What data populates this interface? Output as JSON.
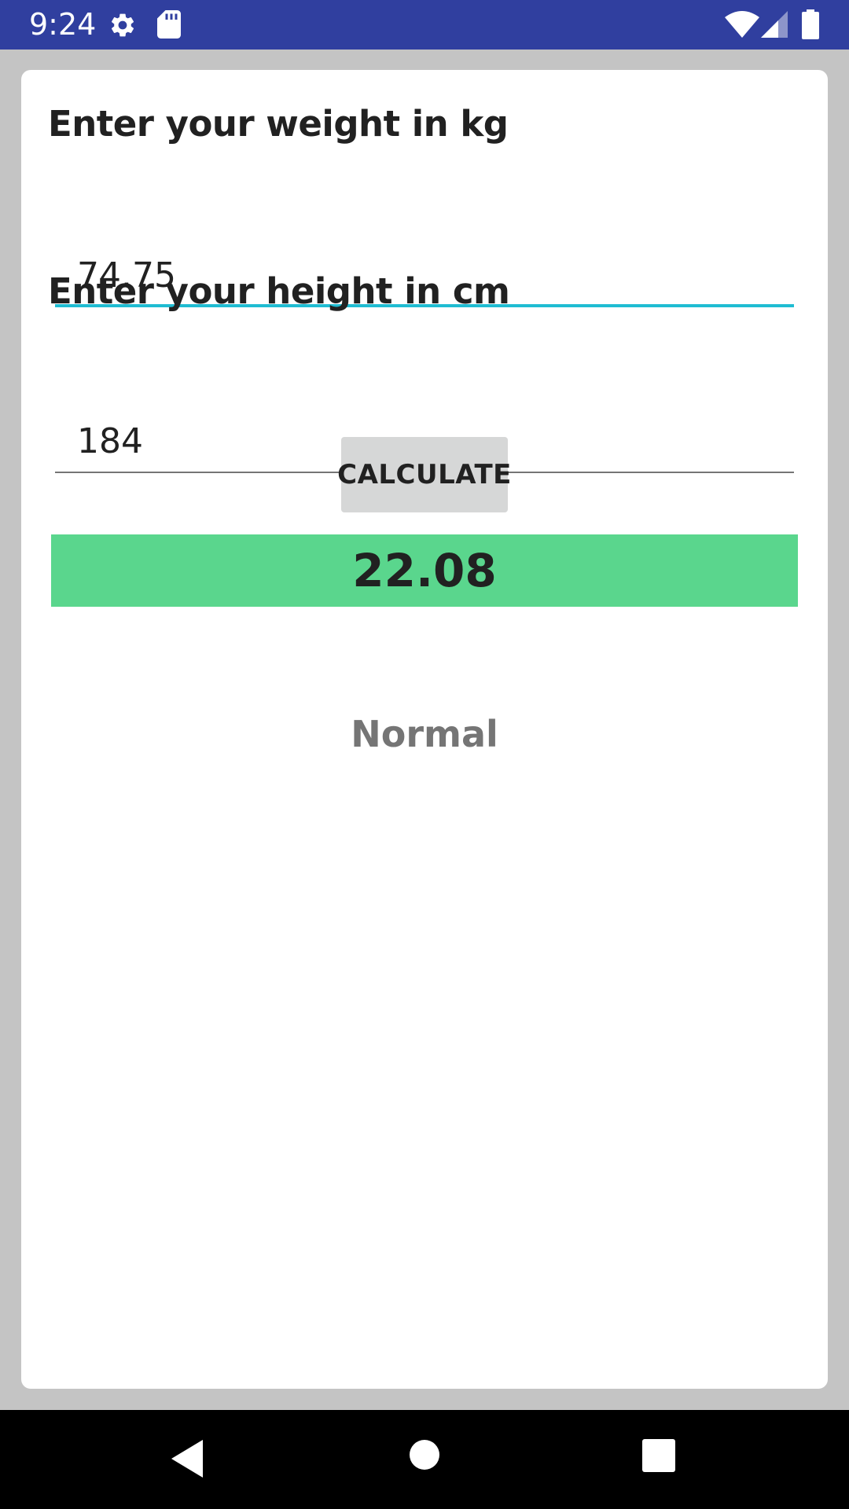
{
  "status_bar": {
    "time": "9:24",
    "background": "#303f9f",
    "icons": [
      "settings-icon",
      "sd-card-icon",
      "wifi-icon",
      "cell-signal-icon",
      "battery-icon"
    ]
  },
  "form": {
    "weight_label": "Enter your weight in kg",
    "weight_value": "74.75",
    "height_label": "Enter your height in cm",
    "height_value": "184",
    "focused_underline_color": "#1fbcd2",
    "underline_color": "#757575"
  },
  "calculate_button": {
    "label": "CALCULATE"
  },
  "result": {
    "bmi": "22.08",
    "category": "Normal",
    "bmi_background": "#5ad68d"
  },
  "nav_bar": {
    "icons": [
      "back-icon",
      "home-icon",
      "recents-icon"
    ]
  }
}
